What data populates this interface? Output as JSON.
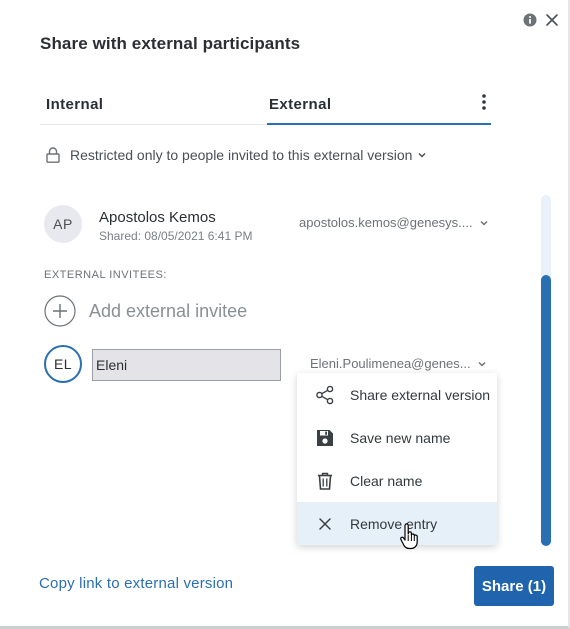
{
  "dialog": {
    "title": "Share with external participants"
  },
  "tabs": [
    {
      "label": "Internal",
      "selected": false
    },
    {
      "label": "External",
      "selected": true
    }
  ],
  "restriction": {
    "text": "Restricted only to people invited to this external version"
  },
  "owner": {
    "initials": "AP",
    "name": "Apostolos Kemos",
    "shared": "Shared: 08/05/2021 6:41 PM",
    "email": "apostolos.kemos@genesys...."
  },
  "invitees": {
    "section_label": "EXTERNAL INVITEES:",
    "add_label": "Add external invitee",
    "entry": {
      "initials": "EL",
      "name_value": "Eleni",
      "email": "Eleni.Poulimenea@genes..."
    }
  },
  "context_menu": {
    "items": [
      {
        "label": "Share external version",
        "icon": "share-icon",
        "active": false
      },
      {
        "label": "Save new name",
        "icon": "save-icon",
        "active": false
      },
      {
        "label": "Clear name",
        "icon": "trash-icon",
        "active": false
      },
      {
        "label": "Remove entry",
        "icon": "close-icon",
        "active": true
      }
    ]
  },
  "footer": {
    "copy_link": "Copy link to external version",
    "share_button": "Share (1)"
  },
  "colors": {
    "accent": "#2a6fb2",
    "button": "#1f64ad",
    "hover": "#e6f0f9"
  }
}
